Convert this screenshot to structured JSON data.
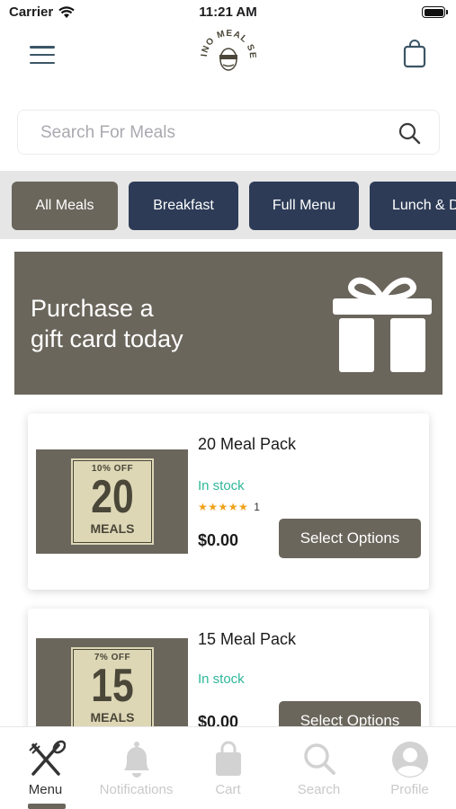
{
  "status_bar": {
    "carrier": "Carrier",
    "time": "11:21 AM"
  },
  "header": {
    "logo_alt": "ILL CHINO MEAL SERVICE",
    "menu_icon": "hamburger-icon",
    "cart_icon": "shopping-bag-icon"
  },
  "search": {
    "placeholder": "Search For Meals",
    "value": ""
  },
  "categories": [
    {
      "label": "All Meals",
      "active": true
    },
    {
      "label": "Breakfast",
      "active": false
    },
    {
      "label": "Full Menu",
      "active": false
    },
    {
      "label": "Lunch & Dinner",
      "active": false
    }
  ],
  "gift_banner": {
    "line1": "Purchase a",
    "line2": "gift card today",
    "icon": "gift-icon"
  },
  "products": [
    {
      "title": "20 Meal Pack",
      "thumb_discount": "10% OFF",
      "thumb_number": "20",
      "thumb_word": "MEALS",
      "stock": "In stock",
      "stars": "★★★★★",
      "rating_count": "1",
      "price": "$0.00",
      "button": "Select Options"
    },
    {
      "title": "15 Meal Pack",
      "thumb_discount": "7% OFF",
      "thumb_number": "15",
      "thumb_word": "MEALS",
      "stock": "In stock",
      "stars": "",
      "rating_count": "",
      "price": "$0.00",
      "button": "Select Options"
    }
  ],
  "tabs": [
    {
      "label": "Menu",
      "icon": "utensils-icon",
      "active": true
    },
    {
      "label": "Notifications",
      "icon": "bell-icon",
      "active": false
    },
    {
      "label": "Cart",
      "icon": "bag-icon",
      "active": false
    },
    {
      "label": "Search",
      "icon": "search-icon",
      "active": false
    },
    {
      "label": "Profile",
      "icon": "user-icon",
      "active": false
    }
  ],
  "colors": {
    "accent": "#6b665c",
    "navy": "#2d3b57",
    "stock_green": "#2fb79a",
    "star": "#f0a21a"
  }
}
